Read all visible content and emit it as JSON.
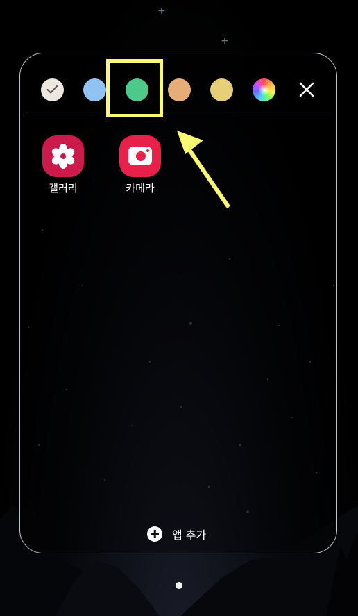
{
  "folder": {
    "color_options": [
      {
        "id": "white",
        "color": "#ece8df",
        "selected": true,
        "icon": "check-icon"
      },
      {
        "id": "blue",
        "color": "#90c2f2",
        "selected": false
      },
      {
        "id": "green",
        "color": "#4dca8a",
        "selected": false
      },
      {
        "id": "orange",
        "color": "#e7ad78",
        "selected": false
      },
      {
        "id": "yellow",
        "color": "#e7cf78",
        "selected": false
      },
      {
        "id": "custom",
        "color": "rainbow",
        "selected": false,
        "icon": "color-wheel-icon"
      }
    ],
    "close_icon": "close-icon",
    "apps": [
      {
        "label": "갤러리",
        "icon": "gallery-flower-icon",
        "color": "#cc1a4a"
      },
      {
        "label": "카메라",
        "icon": "camera-icon",
        "color": "#e8214b"
      }
    ],
    "add_app": {
      "label": "앱 추가",
      "icon": "plus-circle-icon"
    }
  },
  "page_indicator": {
    "pages": 1,
    "current": 1
  },
  "annotation": {
    "highlight_color": "#fbf871",
    "highlighted": "green",
    "arrow_icon": "arrow-icon"
  }
}
